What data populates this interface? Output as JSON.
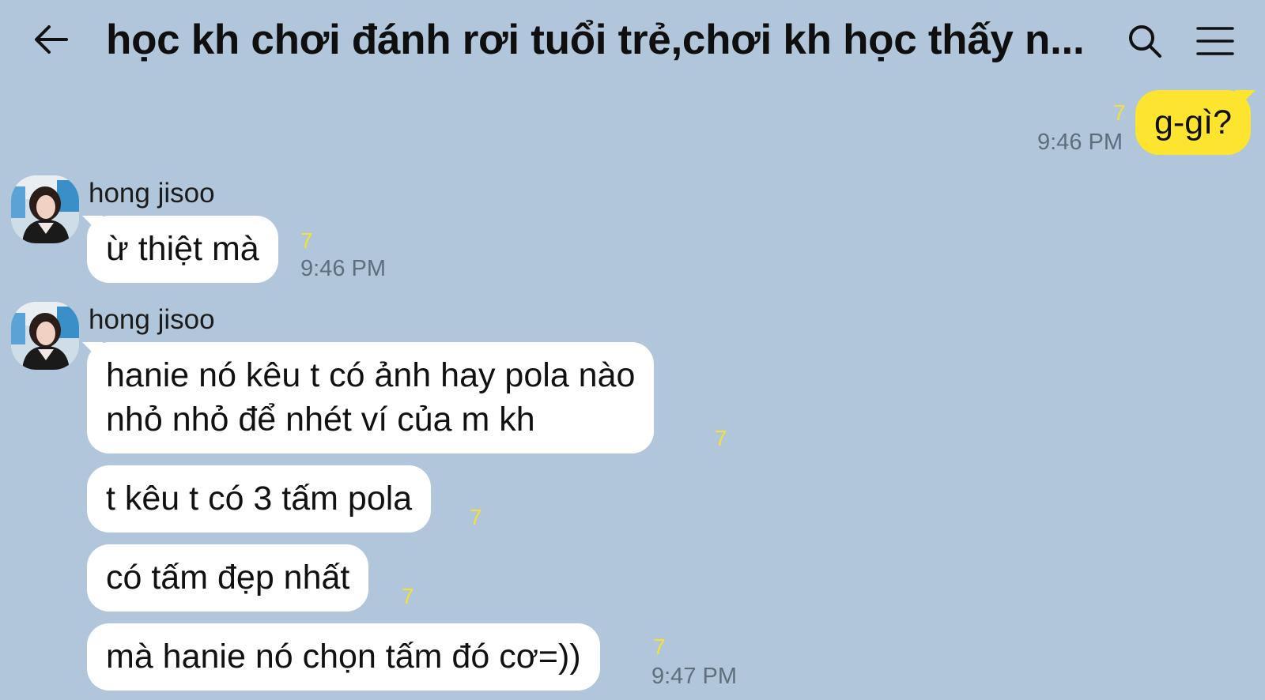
{
  "header": {
    "title": "học kh chơi đánh rơi tuổi trẻ,chơi kh học thấy n..."
  },
  "messages": {
    "m1": {
      "text": "g-gì?",
      "unread": "7",
      "time": "9:46 PM"
    },
    "m2": {
      "sender": "hong jisoo",
      "text": "ừ thiệt mà",
      "unread": "7",
      "time": "9:46 PM"
    },
    "m3": {
      "sender": "hong jisoo",
      "line1": "hanie nó kêu t có ảnh hay pola nào",
      "line2": "nhỏ nhỏ để nhét ví của m kh",
      "unread": "7"
    },
    "m4": {
      "text": "t kêu t có 3 tấm pola",
      "unread": "7"
    },
    "m5": {
      "text": "có tấm đẹp nhất",
      "unread": "7"
    },
    "m6": {
      "text": "mà hanie nó chọn tấm đó cơ=))",
      "unread": "7",
      "time": "9:47 PM"
    }
  },
  "colors": {
    "background": "#b1c6da",
    "my_bubble": "#fde42f",
    "their_bubble": "#ffffff",
    "unread_count": "#f3e03a",
    "timestamp": "#5f6e7c"
  },
  "icons": {
    "back": "arrow-left-icon",
    "search": "search-icon",
    "menu": "hamburger-menu-icon"
  }
}
